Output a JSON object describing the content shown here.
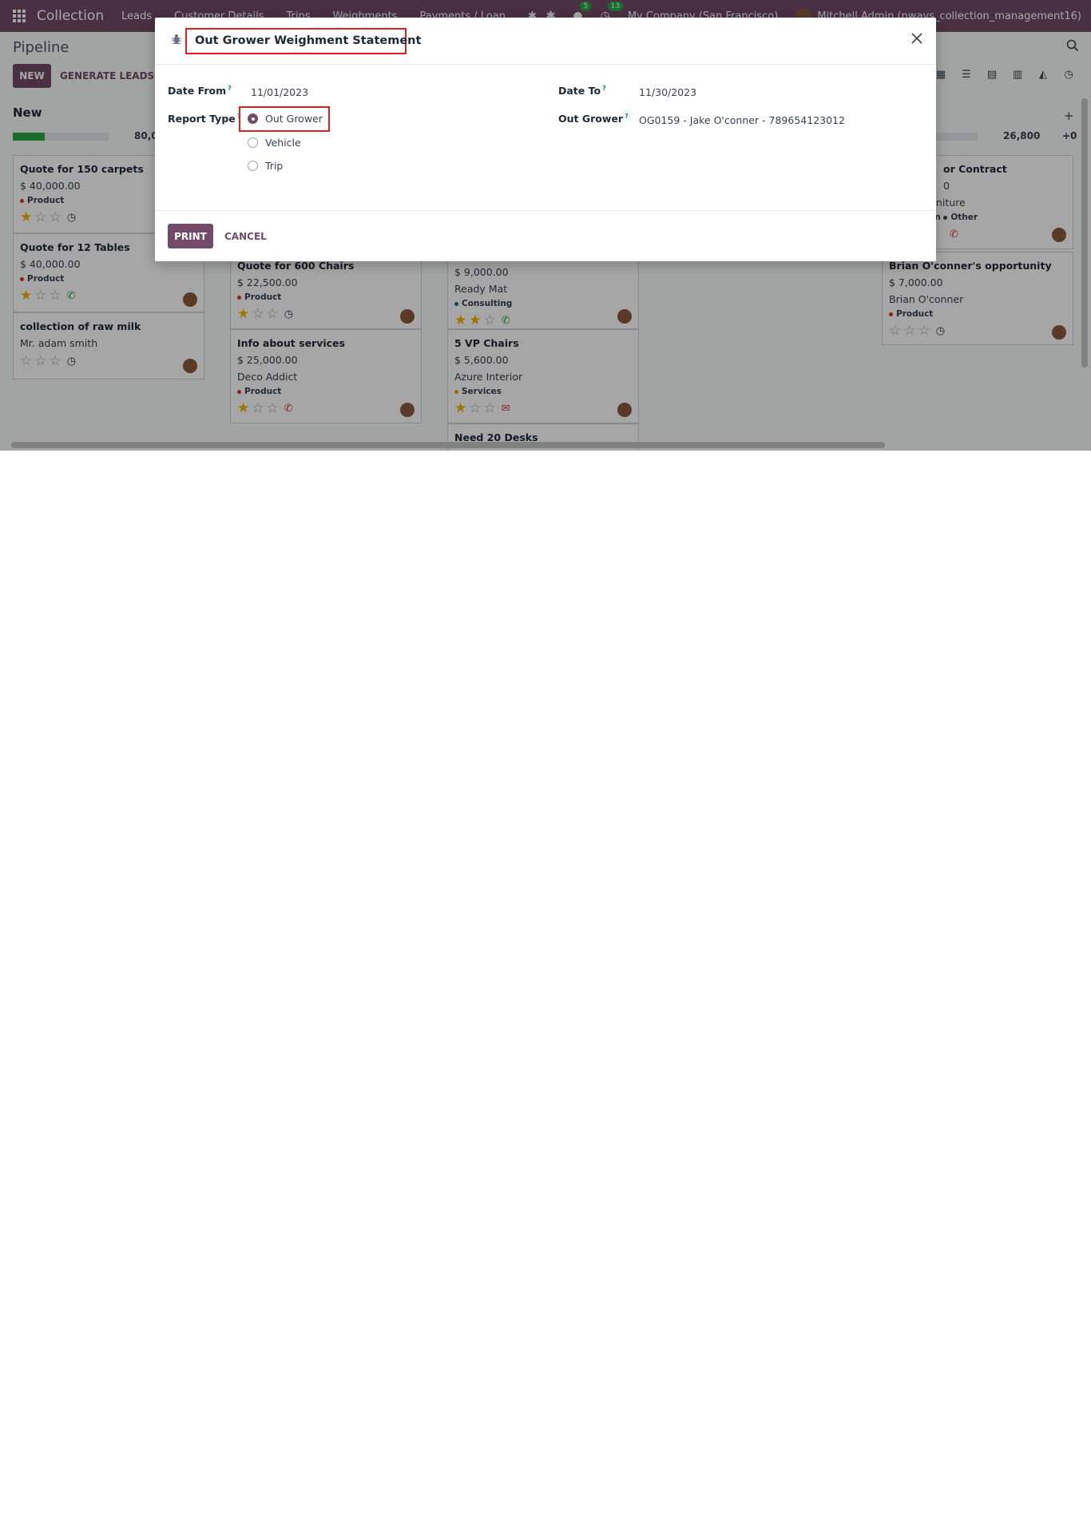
{
  "navbar": {
    "brand": "Collection",
    "menu": [
      "Leads",
      "Customer Details",
      "Trips",
      "Weighments",
      "Payments / Loan"
    ],
    "messages_count": "5",
    "activities_count": "13",
    "company": "My Company (San Francisco)",
    "user": "Mitchell Admin (nways_collection_management16)"
  },
  "control_panel": {
    "breadcrumb": "Pipeline",
    "new_label": "NEW",
    "generate_leads_label": "GENERATE LEADS"
  },
  "kanban": {
    "col_new": {
      "title": "New",
      "total": "80,0",
      "cards": [
        {
          "title": "Quote for 150 carpets",
          "amount": "$ 40,000.00",
          "tag": "Product"
        },
        {
          "title": "Quote for 12 Tables",
          "amount": "$ 40,000.00",
          "tag": "Product"
        },
        {
          "title": "collection of raw milk",
          "contact": "Mr. adam smith"
        }
      ]
    },
    "col_2": {
      "cards": [
        {
          "title": "Quote for 600 Chairs",
          "amount": "$ 22,500.00",
          "tag": "Product"
        },
        {
          "title": "Info about services",
          "amount": "$ 25,000.00",
          "company": "Deco Addict",
          "tag": "Product"
        }
      ]
    },
    "col_3": {
      "cards": [
        {
          "amount": "$ 9,000.00",
          "company": "Ready Mat",
          "tag": "Consulting"
        },
        {
          "title": "5 VP Chairs",
          "amount": "$ 5,600.00",
          "company": "Azure Interior",
          "tag": "Services"
        },
        {
          "title": "Need 20 Desks"
        }
      ]
    },
    "col_5": {
      "total": "26,800",
      "plus": "+0",
      "cards": [
        {
          "title": "or Contract",
          "amount": "0",
          "company": "rniture",
          "tag_a": "on",
          "tag_b": "Other"
        },
        {
          "title": "Brian O'conner's opportunity",
          "amount": "$ 7,000.00",
          "company": "Brian O'conner",
          "tag": "Product"
        }
      ]
    }
  },
  "dialog": {
    "title": "Out Grower Weighment Statement",
    "date_from_label": "Date From",
    "date_from_value": "11/01/2023",
    "date_to_label": "Date To",
    "date_to_value": "11/30/2023",
    "report_type_label": "Report Type",
    "report_options": [
      "Out Grower",
      "Vehicle",
      "Trip"
    ],
    "selected_report_type": "Out Grower",
    "out_grower_label": "Out Grower",
    "out_grower_value": "OG0159 - Jake  O'conner - 789654123012",
    "help_mark": "?",
    "print_label": "PRINT",
    "cancel_label": "CANCEL"
  },
  "colors": {
    "brand": "#714b67",
    "highlight": "#e11d1d",
    "progress": "#28a745",
    "star": "#f3b100"
  }
}
